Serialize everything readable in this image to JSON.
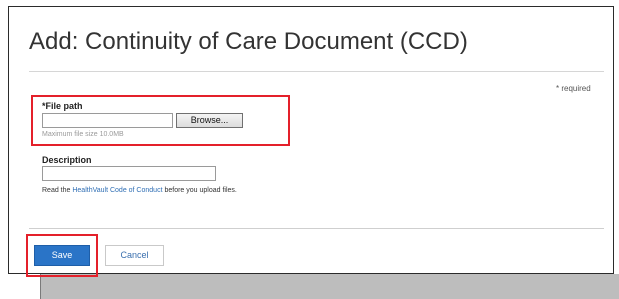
{
  "dialog": {
    "title": "Add: Continuity of Care Document (CCD)",
    "required_note": "* required"
  },
  "form": {
    "file_path": {
      "label": "*File path",
      "value": "",
      "browse_label": "Browse...",
      "hint": "Maximum file size 10.0MB"
    },
    "description": {
      "label": "Description",
      "value": ""
    },
    "conduct": {
      "prefix": "Read the ",
      "link_text": "HealthVault Code of Conduct",
      "suffix": " before you upload files."
    }
  },
  "actions": {
    "save_label": "Save",
    "cancel_label": "Cancel"
  },
  "colors": {
    "highlight": "#e4202a",
    "save_button": "#2a74c7",
    "link": "#2f6eb4"
  }
}
